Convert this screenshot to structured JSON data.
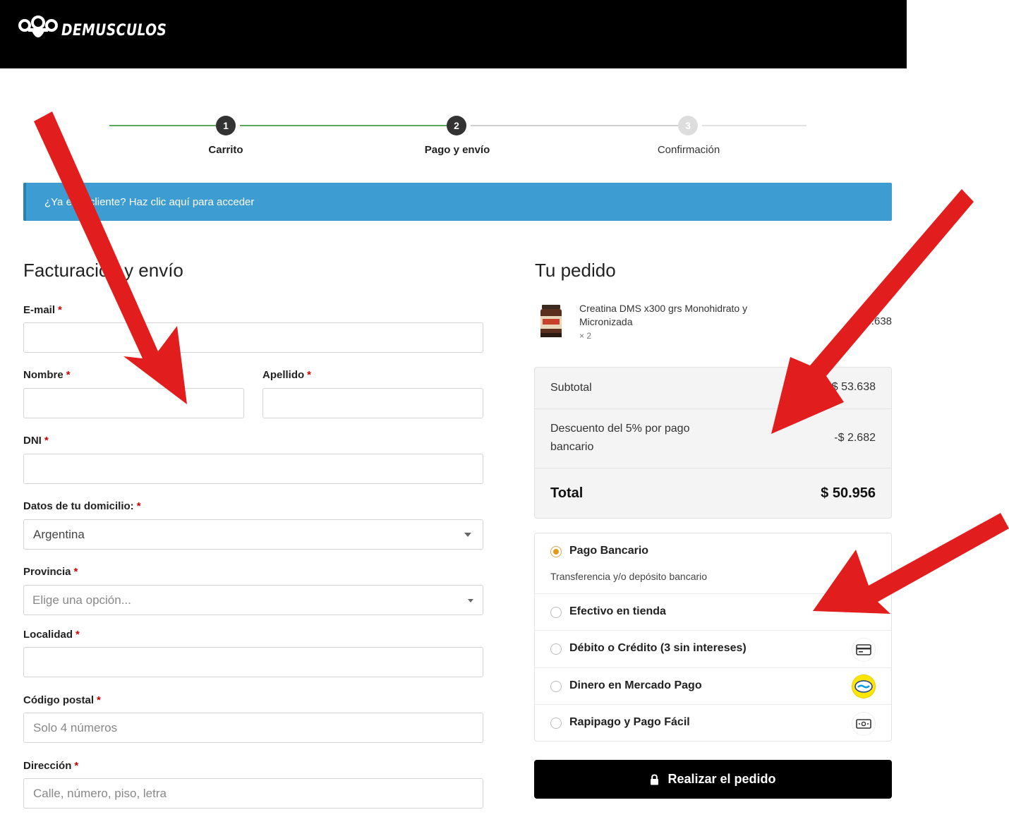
{
  "header": {
    "logo_text": "DEMUSCULOS"
  },
  "steps": [
    {
      "number": "1",
      "label": "Carrito",
      "state": "done"
    },
    {
      "number": "2",
      "label": "Pago y envío",
      "state": "current"
    },
    {
      "number": "3",
      "label": "Confirmación",
      "state": "pending"
    }
  ],
  "login_notice": "¿Ya eres cliente? Haz clic aquí para acceder",
  "billing": {
    "title": "Facturación y envío",
    "required_mark": "*",
    "fields": {
      "email": {
        "label": "E-mail",
        "value": "",
        "placeholder": ""
      },
      "nombre": {
        "label": "Nombre",
        "value": "",
        "placeholder": ""
      },
      "apellido": {
        "label": "Apellido",
        "value": "",
        "placeholder": ""
      },
      "dni": {
        "label": "DNI",
        "value": "",
        "placeholder": ""
      },
      "domicilio": {
        "label": "Datos de tu domicilio:",
        "value": "Argentina"
      },
      "provincia": {
        "label": "Provincia",
        "placeholder": "Elige una opción..."
      },
      "localidad": {
        "label": "Localidad",
        "value": "",
        "placeholder": ""
      },
      "codigo_postal": {
        "label": "Código postal",
        "placeholder": "Solo 4 números"
      },
      "direccion": {
        "label": "Dirección",
        "placeholder": "Calle, número, piso, letra"
      }
    }
  },
  "order": {
    "title": "Tu pedido",
    "product": {
      "name": "Creatina DMS x300 grs Monohidrato y Micronizada",
      "qty": "× 2",
      "price": "$ 53.638"
    },
    "subtotal": {
      "label": "Subtotal",
      "value": "$ 53.638"
    },
    "discount": {
      "label": "Descuento del 5% por pago bancario",
      "value": "-$ 2.682"
    },
    "total": {
      "label": "Total",
      "value": "$ 50.956"
    }
  },
  "payment_methods": [
    {
      "label": "Pago Bancario",
      "description": "Transferencia y/o depósito bancario",
      "selected": true,
      "icon": ""
    },
    {
      "label": "Efectivo en tienda",
      "selected": false,
      "icon": ""
    },
    {
      "label": "Débito o Crédito (3 sin intereses)",
      "selected": false,
      "icon": "credit-card-icon"
    },
    {
      "label": "Dinero en Mercado Pago",
      "selected": false,
      "icon": "mercado-pago-icon"
    },
    {
      "label": "Rapipago y Pago Fácil",
      "selected": false,
      "icon": "cash-icon"
    }
  ],
  "place_order_label": "Realizar el pedido",
  "colors": {
    "header_bg": "#000000",
    "notice_bg": "#3d9cd2",
    "progress_done": "#5aa95a",
    "progress_pending": "#cccccc",
    "radio_selected": "#e09a1e",
    "required": "#cc0000",
    "annotation_arrow": "#e21d1d"
  }
}
